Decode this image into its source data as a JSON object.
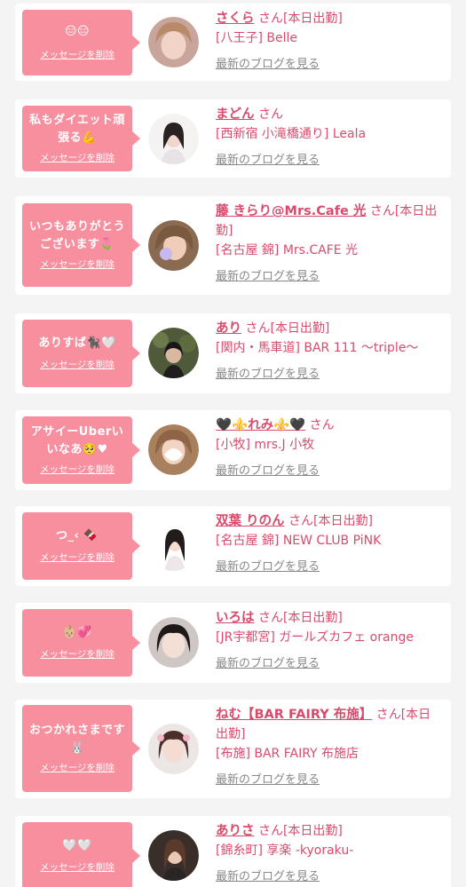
{
  "common": {
    "delete_label": "メッセージを削除",
    "blog_label": "最新のブログを見る",
    "san": "さん",
    "today": "[本日出勤]"
  },
  "items": [
    {
      "message": "😑😑",
      "name": "さくら",
      "suffix": "さん[本日出勤]",
      "shop": "[八王子] Belle"
    },
    {
      "message": "私もダイエット頑張る💪",
      "name": "まどん",
      "suffix": "さん",
      "shop": "[西新宿 小滝橋通り] Leala"
    },
    {
      "message": "いつもありがとうございます🌷",
      "name": "藤 きらり@Mrs.Cafe 光",
      "suffix": "さん[本日出勤]",
      "shop": "[名古屋 錦] Mrs.CAFE 光"
    },
    {
      "message": "ありすば🐈‍⬛🤍",
      "name": "あり",
      "suffix": "さん[本日出勤]",
      "shop": "[関内・馬車道] BAR 111 〜triple〜"
    },
    {
      "message": "アサイーUberいいなあ🥺♥",
      "name": "🖤⚜️れみ⚜️🖤",
      "suffix": "さん",
      "shop": "[小牧] mrs.J 小牧"
    },
    {
      "message": "つ_‹ 🍫",
      "name": "双葉 りのん",
      "suffix": "さん[本日出勤]",
      "shop": "[名古屋 錦] NEW CLUB PiNK"
    },
    {
      "message": "👶🏼💞",
      "name": "いろは",
      "suffix": "さん[本日出勤]",
      "shop": "[JR宇都宮] ガールズカフェ orange"
    },
    {
      "message": "おつかれさまです🐰",
      "name": "ねむ【BAR FAIRY 布施】",
      "suffix": "さん[本日出勤]",
      "shop": "[布施] BAR FAIRY 布施店"
    },
    {
      "message": "🤍🤍",
      "name": "ありさ",
      "suffix": "さん[本日出勤]",
      "shop": "[錦糸町] 享楽 -kyoraku-"
    }
  ],
  "colors": {
    "bubble": "#f78f9f",
    "name": "#d94b6c",
    "background": "#f4f4f4",
    "card": "#ffffff"
  }
}
